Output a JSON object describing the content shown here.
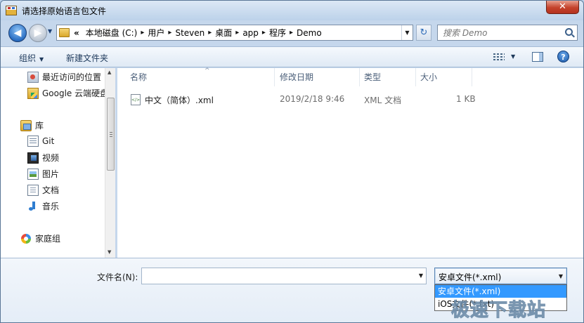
{
  "window": {
    "title": "请选择原始语言包文件",
    "close_glyph": "✕"
  },
  "nav": {
    "back_glyph": "◀",
    "forward_glyph": "▶",
    "history_glyph": "▼",
    "refresh_glyph": "↻"
  },
  "address": {
    "more": "«",
    "crumbs": [
      "本地磁盘 (C:)",
      "用户",
      "Steven",
      "桌面",
      "app",
      "程序",
      "Demo"
    ],
    "sep": "▸",
    "drop_glyph": "▼"
  },
  "search": {
    "placeholder": "搜索 Demo"
  },
  "toolbar": {
    "organize": "组织",
    "new_folder": "新建文件夹",
    "caret": "▼",
    "help": "?"
  },
  "navpane": {
    "recent": "最近访问的位置",
    "gdrive": "Google 云端硬盘",
    "library": "库",
    "git": "Git",
    "video": "视频",
    "images": "图片",
    "docs": "文档",
    "music": "音乐",
    "homegroup": "家庭组",
    "scroll_up": "▲",
    "scroll_down": "▼"
  },
  "list": {
    "columns": {
      "name": "名称",
      "date": "修改日期",
      "type": "类型",
      "size": "大小"
    },
    "sort_glyph": "^",
    "files": [
      {
        "name": "中文（简体）.xml",
        "date": "2019/2/18 9:46",
        "type": "XML 文档",
        "size": "1 KB"
      }
    ]
  },
  "bottom": {
    "filename_label": "文件名(N):",
    "filename_value": "",
    "filetype_selected": "安卓文件(*.xml)",
    "filetype_options": [
      "安卓文件(*.xml)",
      "iOS文件(*.txt)"
    ],
    "drop_glyph": "▼"
  },
  "watermark": "极速下载站"
}
